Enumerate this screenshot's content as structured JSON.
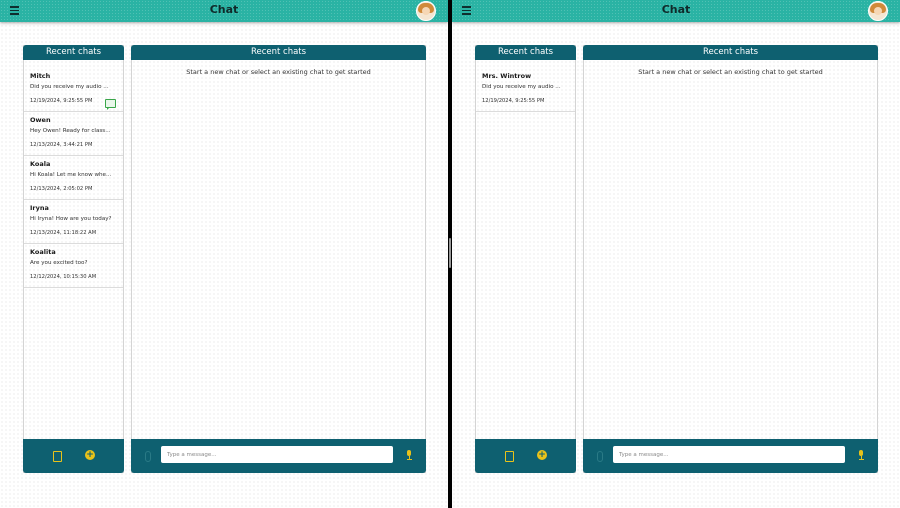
{
  "app": {
    "title": "Chat"
  },
  "left_pane": {
    "sidebar_title": "Recent chats",
    "main_title": "Recent chats",
    "empty_message": "Start a new chat or select an existing chat to get started",
    "input_placeholder": "Type a message...",
    "chats": [
      {
        "name": "Mitch",
        "preview": "Did you receive my audio ...",
        "time": "12/19/2024, 9:25:55 PM",
        "has_badge": true
      },
      {
        "name": "Owen",
        "preview": "Hey Owen! Ready for class...",
        "time": "12/13/2024, 3:44:21 PM",
        "has_badge": false
      },
      {
        "name": "Koala",
        "preview": "Hi Koala! Let me know whe...",
        "time": "12/13/2024, 2:05:02 PM",
        "has_badge": false
      },
      {
        "name": "Iryna",
        "preview": "Hi Iryna! How are you today?",
        "time": "12/13/2024, 11:18:22 AM",
        "has_badge": false
      },
      {
        "name": "Koalita",
        "preview": "Are you excited too?",
        "time": "12/12/2024, 10:15:30 AM",
        "has_badge": false
      }
    ]
  },
  "right_pane": {
    "sidebar_title": "Recent chats",
    "main_title": "Recent chats",
    "empty_message": "Start a new chat or select an existing chat to get started",
    "input_placeholder": "Type a message...",
    "chats": [
      {
        "name": "Mrs. Wintrow",
        "preview": "Did you receive my audio ...",
        "time": "12/19/2024, 9:25:55 PM",
        "has_badge": false
      }
    ]
  },
  "colors": {
    "topbar": "#2ab3a4",
    "panel_header": "#0e6070",
    "accent_icon": "#e8c21a",
    "badge": "#3aa64a"
  },
  "icons": {
    "menu": "menu-icon",
    "avatar": "avatar",
    "new_doc": "document-icon",
    "add": "plus-circle-icon",
    "attach": "paperclip-icon",
    "mic": "microphone-icon",
    "unread": "message-badge-icon"
  }
}
